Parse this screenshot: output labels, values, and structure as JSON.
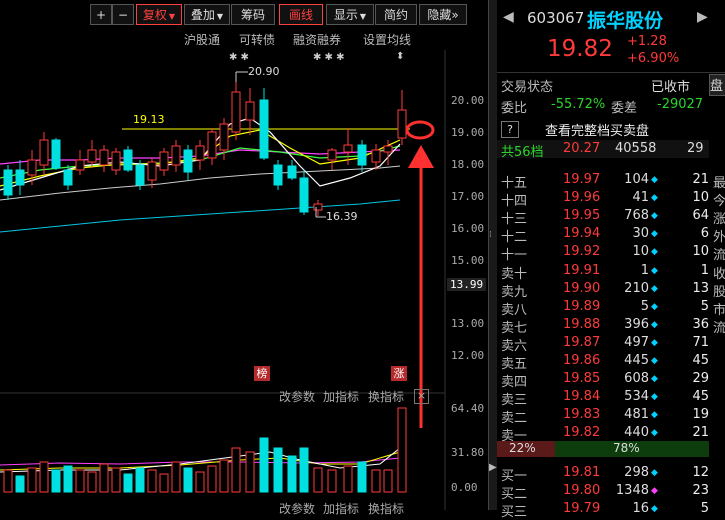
{
  "toolbar": {
    "plus": "+",
    "minus": "−",
    "fuquan": "复权",
    "diejia": "叠加",
    "chouma": "筹码",
    "huaxian": "画线",
    "xianshi": "显示",
    "jianyue": "简约",
    "yincang": "隐藏",
    "more": "»"
  },
  "sublinks": {
    "hgt": "沪股通",
    "kzz": "可转债",
    "rzrq": "融资融券",
    "szjx": "设置均线"
  },
  "price_axis": [
    "20.00",
    "19.00",
    "18.00",
    "17.00",
    "16.00",
    "15.00",
    "13.99",
    "13.00",
    "12.00"
  ],
  "vol_axis": [
    "64.40",
    "31.80",
    "0.00"
  ],
  "annotations": {
    "high": "20.90",
    "low": "16.39",
    "level": "19.13",
    "stars1": "✱ ✱",
    "stars2": "✱ ✱ ✱",
    "bang": "榜",
    "zhang": "涨"
  },
  "indicator_bar": {
    "gaicanshu": "改参数",
    "jiazhibiao": "加指标",
    "huanzhibiao": "换指标",
    "close": "×"
  },
  "quote": {
    "code": "603067",
    "name": "振华股份",
    "price": "19.82",
    "change": "+1.28",
    "change_pct": "+6.90%",
    "status_label": "交易状态",
    "status_value": "已收市",
    "weibi_label": "委比",
    "weibi_value": "-55.72%",
    "weicha_label": "委差",
    "weicha_value": "-29027",
    "help_icon": "?",
    "full_book": "查看完整档买卖盘",
    "total_label": "共56档",
    "total_price": "20.27",
    "total_vol": "40558",
    "total_count": "29",
    "ratio_sell": "22%",
    "ratio_buy": "78%"
  },
  "order_book": [
    {
      "label": "十五",
      "price": "19.97",
      "vol": "104",
      "dia": "◆",
      "ch": "21",
      "cut": "最"
    },
    {
      "label": "十四",
      "price": "19.96",
      "vol": "41",
      "dia": "◆",
      "ch": "10",
      "cut": "今"
    },
    {
      "label": "十三",
      "price": "19.95",
      "vol": "768",
      "dia": "◆",
      "ch": "64",
      "cut": "涨"
    },
    {
      "label": "十二",
      "price": "19.94",
      "vol": "30",
      "dia": "◆",
      "ch": "6",
      "cut": "外"
    },
    {
      "label": "十一",
      "price": "19.92",
      "vol": "10",
      "dia": "◆",
      "ch": "10",
      "cut": "流"
    },
    {
      "label": "卖十",
      "price": "19.91",
      "vol": "1",
      "dia": "◆",
      "ch": "1",
      "cut": "收"
    },
    {
      "label": "卖九",
      "price": "19.90",
      "vol": "210",
      "dia": "◆",
      "ch": "13",
      "cut": "股"
    },
    {
      "label": "卖八",
      "price": "19.89",
      "vol": "5",
      "dia": "◆",
      "ch": "5",
      "cut": "市"
    },
    {
      "label": "卖七",
      "price": "19.88",
      "vol": "396",
      "dia": "◆",
      "ch": "36",
      "cut": "流"
    },
    {
      "label": "卖六",
      "price": "19.87",
      "vol": "497",
      "dia": "◆",
      "ch": "71",
      "cut": ""
    },
    {
      "label": "卖五",
      "price": "19.86",
      "vol": "445",
      "dia": "◆",
      "ch": "45",
      "cut": ""
    },
    {
      "label": "卖四",
      "price": "19.85",
      "vol": "608",
      "dia": "◆",
      "ch": "29",
      "cut": ""
    },
    {
      "label": "卖三",
      "price": "19.84",
      "vol": "534",
      "dia": "◆",
      "ch": "45",
      "cut": ""
    },
    {
      "label": "卖二",
      "price": "19.83",
      "vol": "481",
      "dia": "◆",
      "ch": "19",
      "cut": ""
    },
    {
      "label": "卖一",
      "price": "19.82",
      "vol": "440",
      "dia": "◆",
      "ch": "21",
      "cut": ""
    },
    {
      "label": "买一",
      "price": "19.81",
      "vol": "298",
      "dia": "◆",
      "ch": "12",
      "cut": ""
    },
    {
      "label": "买二",
      "price": "19.80",
      "vol": "1348",
      "dia": "◆",
      "ch": "23",
      "cut": ""
    },
    {
      "label": "买三",
      "price": "19.79",
      "vol": "16",
      "dia": "◆",
      "ch": "5",
      "cut": ""
    }
  ],
  "right_tab": "盘",
  "colors": {
    "up": "#ff3a3a",
    "down": "#2bd52b",
    "cyan": "#00e0e0",
    "name": "#00d2ff",
    "ma_white": "#ffffff",
    "ma_yellow": "#ffff00",
    "ma_magenta": "#ff40ff",
    "ma_green": "#40ff40"
  }
}
